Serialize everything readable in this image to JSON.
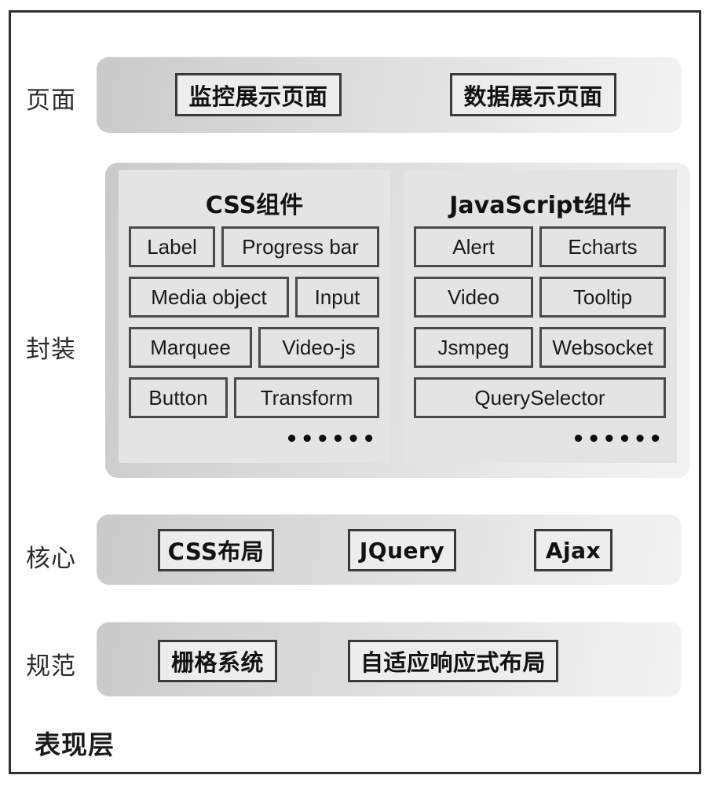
{
  "diagram": {
    "bottom_caption": "表现层",
    "layers": [
      {
        "label": "页面"
      },
      {
        "label": "封装"
      },
      {
        "label": "核心"
      },
      {
        "label": "规范"
      }
    ]
  },
  "page_layer": {
    "label": "页面",
    "items": [
      {
        "text": "监控展示页面"
      },
      {
        "text": "数据展示页面"
      }
    ]
  },
  "encapsulation_layer": {
    "label": "封装",
    "panels": [
      {
        "title": "CSS组件",
        "ellipsis": "••••••",
        "rows": [
          [
            {
              "text": "Label"
            },
            {
              "text": "Progress bar"
            }
          ],
          [
            {
              "text": "Media object"
            },
            {
              "text": "Input"
            }
          ],
          [
            {
              "text": "Marquee"
            },
            {
              "text": "Video-js"
            }
          ],
          [
            {
              "text": "Button"
            },
            {
              "text": "Transform"
            }
          ]
        ]
      },
      {
        "title": "JavaScript组件",
        "ellipsis": "••••••",
        "rows": [
          [
            {
              "text": "Alert"
            },
            {
              "text": "Echarts"
            }
          ],
          [
            {
              "text": "Video"
            },
            {
              "text": "Tooltip"
            }
          ],
          [
            {
              "text": "Jsmpeg"
            },
            {
              "text": "Websocket"
            }
          ],
          [
            {
              "text": "QuerySelector"
            }
          ]
        ]
      }
    ]
  },
  "core_layer": {
    "label": "核心",
    "items": [
      {
        "text": "CSS布局"
      },
      {
        "text": "JQuery"
      },
      {
        "text": "Ajax"
      }
    ]
  },
  "spec_layer": {
    "label": "规范",
    "items": [
      {
        "text": "栅格系统"
      },
      {
        "text": "自适应响应式布局"
      }
    ]
  },
  "colors": {
    "frame_border": "#2e2e2e",
    "band_gradient_start": "#c9c9c9",
    "band_gradient_end": "#f2f2f2",
    "panel_bg": "#e4e4e4",
    "chip_border": "#3a3a3a",
    "box_border": "#4a4a4a",
    "text": "#1a1a1a"
  }
}
